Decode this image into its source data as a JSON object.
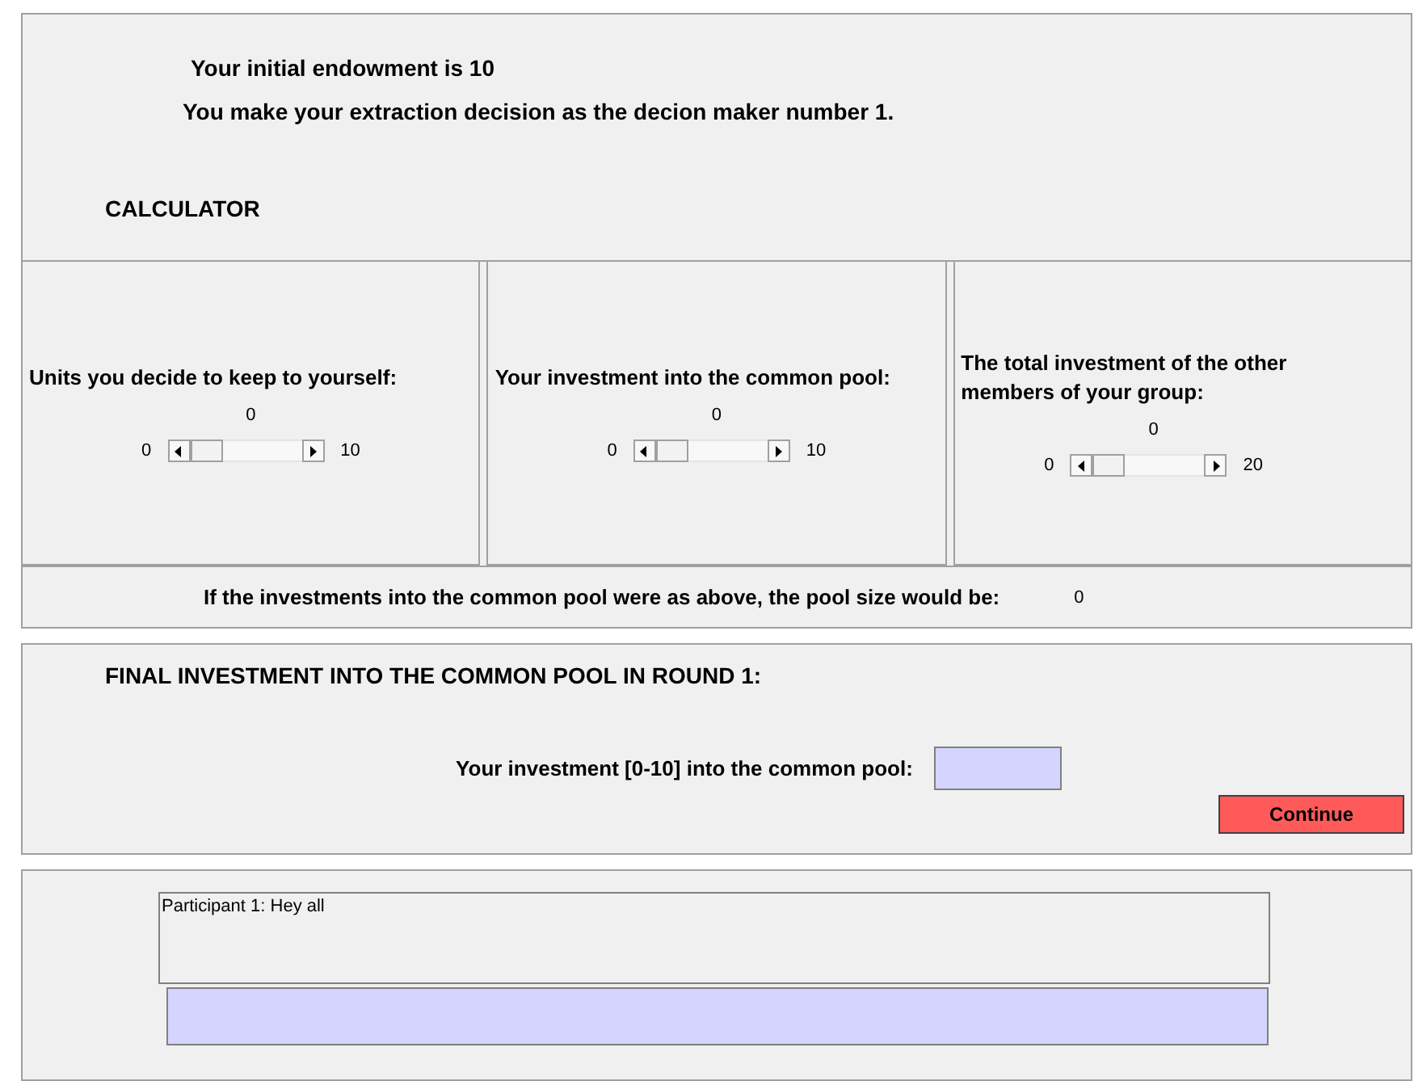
{
  "header": {
    "endowment_text": "Your initial endowment is 10",
    "decision_text": "You make your extraction decision as the decion maker number 1.",
    "calculator_title": "CALCULATOR"
  },
  "calculators": [
    {
      "label": "Units you decide to keep to yourself:",
      "value": "0",
      "min": "0",
      "max": "10",
      "level": 0
    },
    {
      "label": "Your investment into the common pool:",
      "value": "0",
      "min": "0",
      "max": "10",
      "level": 0
    },
    {
      "label": "The total investment of the other members of your group:",
      "value": "0",
      "min": "0",
      "max": "20",
      "level": 0
    }
  ],
  "pool": {
    "label": "If the investments into the common pool were as above, the pool size would be:",
    "value": "0"
  },
  "final": {
    "title": "FINAL INVESTMENT INTO THE COMMON POOL IN ROUND 1:",
    "field_label": "Your investment [0-10] into the common pool:",
    "button": "Continue"
  },
  "chat": {
    "messages": [
      "Participant 1: Hey all"
    ]
  }
}
